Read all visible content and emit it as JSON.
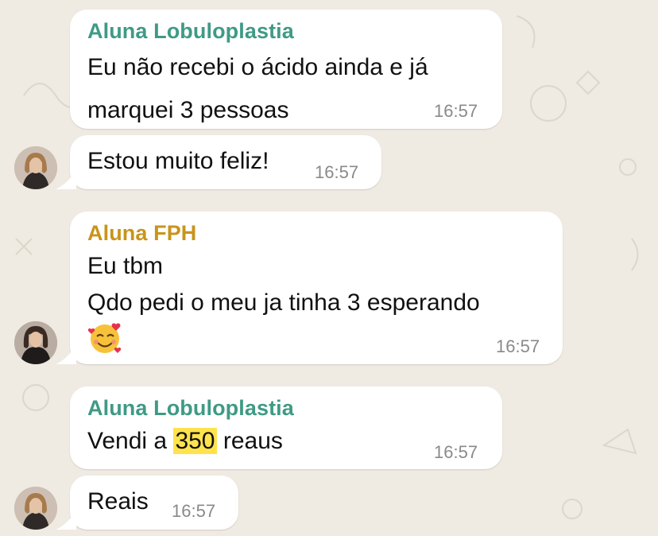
{
  "colors": {
    "chat_background": "#efeae2",
    "bubble": "#ffffff",
    "sender_green": "#3f9a85",
    "sender_orange": "#c9941b",
    "highlight": "#ffe34d",
    "timestamp": "#8a8a8a"
  },
  "messages": [
    {
      "sender": "Aluna Lobuloplastia",
      "lines": [
        "Eu não recebi o ácido ainda e já",
        "marquei 3 pessoas"
      ],
      "time": "16:57"
    },
    {
      "lines": [
        "Estou muito feliz!"
      ],
      "time": "16:57",
      "avatar_icon": "user-avatar-photo"
    },
    {
      "sender": "Aluna FPH",
      "lines": [
        "Eu tbm",
        "Qdo pedi o meu ja tinha 3 esperando"
      ],
      "emoji": "smiling-face-with-hearts",
      "time": "16:57",
      "avatar_icon": "user-avatar-photo"
    },
    {
      "sender": "Aluna Lobuloplastia",
      "text_before": "Vendi a ",
      "highlight": "350",
      "text_after": " reaus",
      "time": "16:57"
    },
    {
      "lines": [
        "Reais"
      ],
      "time": "16:57",
      "avatar_icon": "user-avatar-photo"
    }
  ]
}
